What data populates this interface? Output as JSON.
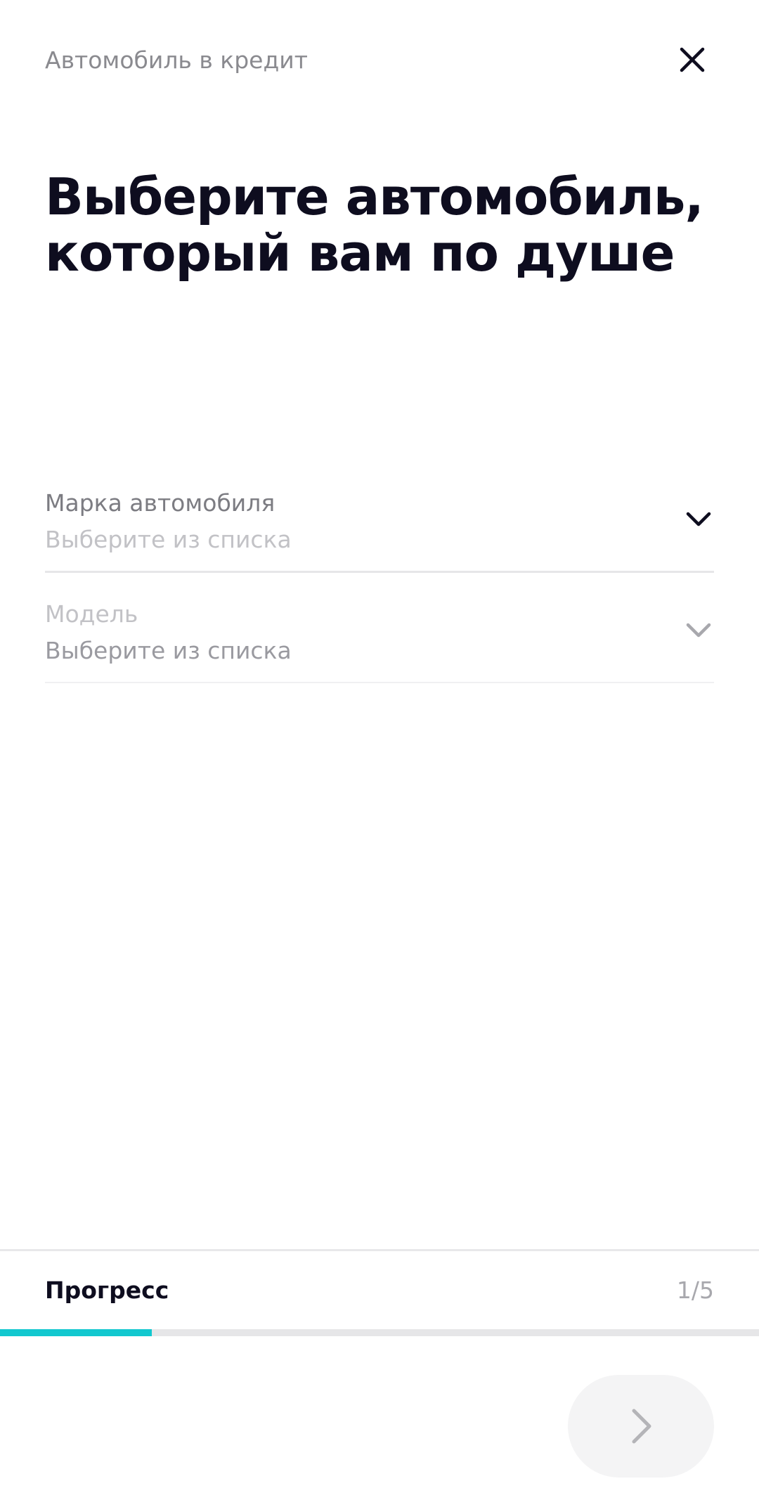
{
  "header": {
    "title": "Автомобиль в кредит",
    "close_icon": "close-icon"
  },
  "headline": {
    "line1": "Выберите автомобиль,",
    "line2": "который вам по душе"
  },
  "form": {
    "brand": {
      "label": "Марка автомобиля",
      "placeholder": "Выберите из списка",
      "icon": "chevron-down-icon",
      "enabled": true
    },
    "model": {
      "label": "Модель",
      "placeholder": "Выберите из списка",
      "icon": "chevron-down-icon",
      "enabled": false
    }
  },
  "footer": {
    "progress_label": "Прогресс",
    "step_text": "1/5",
    "progress_fraction": 0.2,
    "accent_color": "#12c8cf",
    "next_icon": "chevron-right-icon"
  }
}
